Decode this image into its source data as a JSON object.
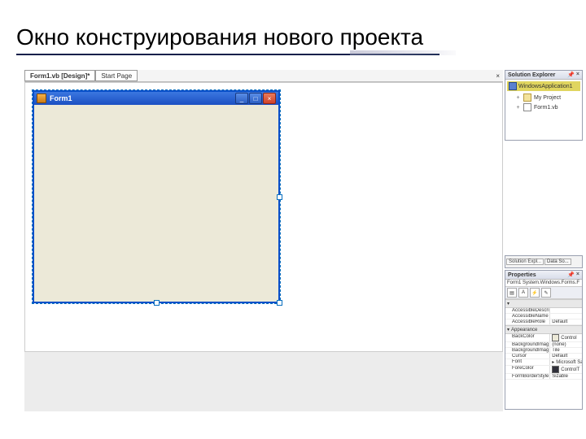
{
  "slide": {
    "title": "Окно конструирования нового проекта"
  },
  "ide": {
    "tabs": [
      {
        "label": "Form1.vb [Design]*"
      },
      {
        "label": "Start Page"
      }
    ],
    "closeGlyph": "×"
  },
  "form": {
    "title": "Form1",
    "btn_min": "_",
    "btn_max": "□",
    "btn_close": "×"
  },
  "solexp": {
    "title": "Solution Explorer",
    "pin": "📌",
    "close": "×",
    "root": "WindowsApplication1",
    "items": [
      {
        "label": "My Project"
      },
      {
        "label": "Form1.vb"
      }
    ]
  },
  "panelTabs": {
    "a": "Solution Expl...",
    "b": "Data So..."
  },
  "props": {
    "title": "Properties",
    "object": "Form1 System.Windows.Forms.F",
    "cat_access": "",
    "rows_access": [
      {
        "name": "AccessibleDescri",
        "value": ""
      },
      {
        "name": "AccessibleName",
        "value": ""
      },
      {
        "name": "AccessibleRole",
        "value": "Default"
      }
    ],
    "cat_appearance": "Appearance",
    "rows_appearance": [
      {
        "name": "BackColor",
        "value": "Control"
      },
      {
        "name": "BackgroundImag",
        "value": "(none)"
      },
      {
        "name": "BackgroundImag",
        "value": "Tile"
      },
      {
        "name": "Cursor",
        "value": "Default"
      },
      {
        "name": "Font",
        "value": "Microsoft San"
      },
      {
        "name": "ForeColor",
        "value": "ControlT"
      },
      {
        "name": "FormBorderStyle",
        "value": "Sizable"
      }
    ]
  }
}
